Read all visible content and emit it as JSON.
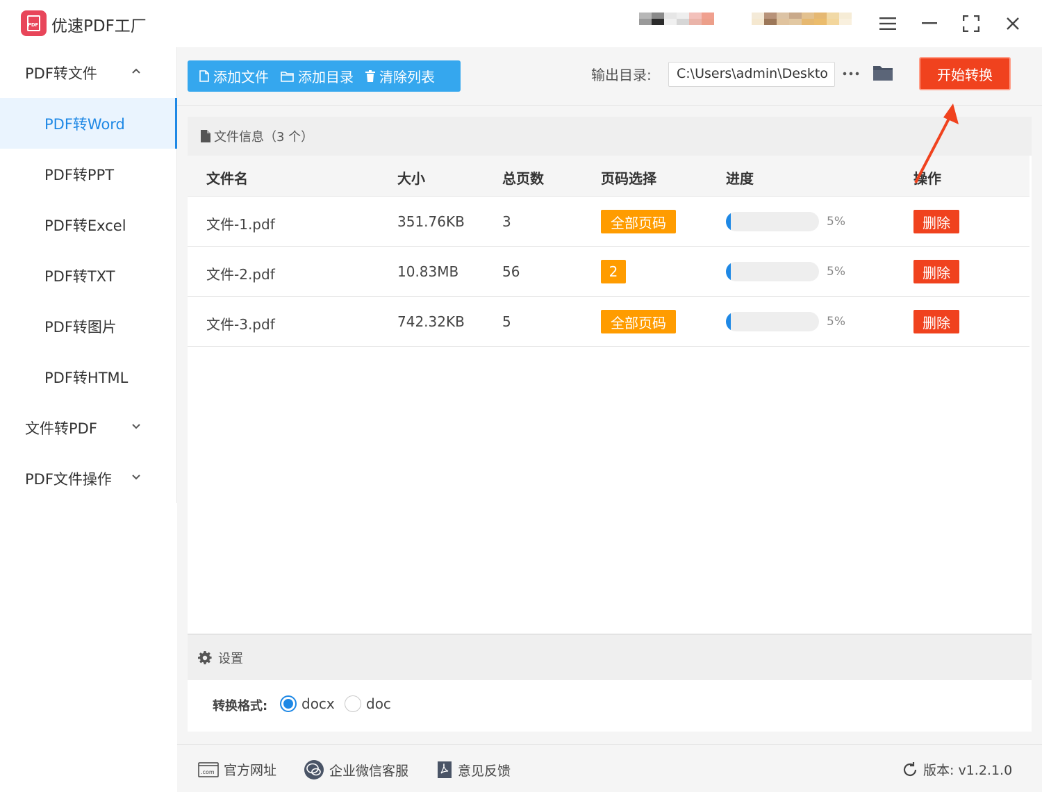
{
  "app": {
    "title": "优速PDF工厂",
    "logo_text": "PDF"
  },
  "window_controls": {
    "menu": "menu-icon",
    "minimize": "minimize-icon",
    "maximize": "fullscreen-icon",
    "close": "close-icon"
  },
  "sidebar": {
    "groups": [
      {
        "label": "PDF转文件",
        "expanded": true
      },
      {
        "label": "文件转PDF",
        "expanded": false
      },
      {
        "label": "PDF文件操作",
        "expanded": false
      }
    ],
    "items": [
      {
        "label": "PDF转Word",
        "active": true
      },
      {
        "label": "PDF转PPT"
      },
      {
        "label": "PDF转Excel"
      },
      {
        "label": "PDF转TXT"
      },
      {
        "label": "PDF转图片"
      },
      {
        "label": "PDF转HTML"
      }
    ]
  },
  "toolbar": {
    "add_file": "添加文件",
    "add_dir": "添加目录",
    "clear_list": "清除列表",
    "output_label": "输出目录:",
    "output_path": "C:\\Users\\admin\\Deskto",
    "more": "···",
    "start": "开始转换"
  },
  "file_panel": {
    "title": "文件信息（3 个）",
    "columns": {
      "name": "文件名",
      "size": "大小",
      "pages": "总页数",
      "page_select": "页码选择",
      "progress": "进度",
      "action": "操作"
    },
    "rows": [
      {
        "name": "文件-1.pdf",
        "size": "351.76KB",
        "pages": "3",
        "page_select": "全部页码",
        "progress": 0.05,
        "progress_text": "5%",
        "action": "删除"
      },
      {
        "name": "文件-2.pdf",
        "size": "10.83MB",
        "pages": "56",
        "page_select": "2",
        "progress": 0.05,
        "progress_text": "5%",
        "action": "删除"
      },
      {
        "name": "文件-3.pdf",
        "size": "742.32KB",
        "pages": "5",
        "page_select": "全部页码",
        "progress": 0.05,
        "progress_text": "5%",
        "action": "删除"
      }
    ]
  },
  "settings": {
    "title": "设置",
    "format_label": "转换格式:",
    "options": [
      {
        "label": "docx",
        "selected": true
      },
      {
        "label": "doc",
        "selected": false
      }
    ]
  },
  "footer": {
    "website": "官方网址",
    "wechat": "企业微信客服",
    "feedback": "意见反馈",
    "version": "版本:  v1.2.1.0"
  },
  "colors": {
    "accent": "#1e88e5",
    "toolbar_blue": "#35a7ee",
    "danger": "#f0421e",
    "badge": "#ff9c00"
  }
}
